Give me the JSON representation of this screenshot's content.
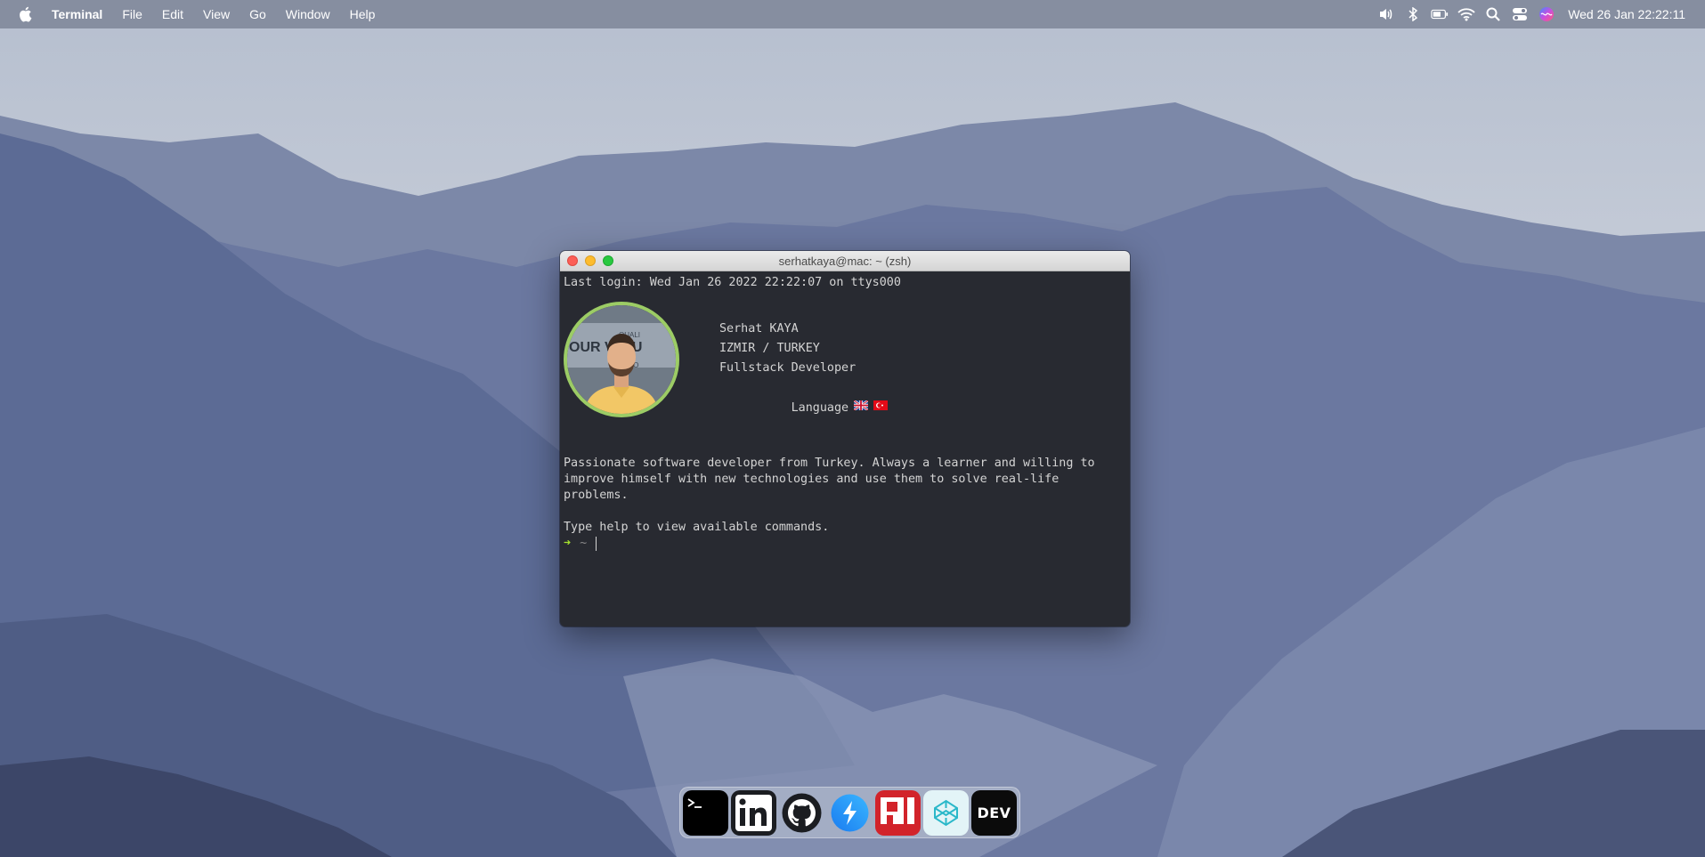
{
  "menubar": {
    "app_name": "Terminal",
    "menus": [
      "File",
      "Edit",
      "View",
      "Go",
      "Window",
      "Help"
    ],
    "status_icons": [
      "volume-icon",
      "bluetooth-icon",
      "battery-icon",
      "wifi-icon",
      "search-icon",
      "control-center-icon",
      "siri-icon"
    ],
    "clock": "Wed 26 Jan 22:22:11"
  },
  "terminal": {
    "title": "serhatkaya@mac: ~ (zsh)",
    "last_login": "Last login: Wed Jan 26 2022 22:22:07 on ttys000",
    "profile": {
      "name": "Serhat KAYA",
      "location": "IZMIR / TURKEY",
      "role": "Fullstack Developer",
      "language_label": "Language"
    },
    "bio": "Passionate software developer from Turkey. Always a learner and willing to improve himself with new technologies and use them to solve real-life problems.",
    "help_text": "Type help to view available commands.",
    "prompt_arrow": "➜",
    "prompt_dir": "~"
  },
  "dock": {
    "apps": [
      "terminal-app",
      "linkedin-app",
      "github-app",
      "messenger-app",
      "polywork-app",
      "codepen-app",
      "dev-app"
    ],
    "dev_label": "DEV"
  },
  "colors": {
    "terminal_bg": "#282a31",
    "prompt_arrow": "#a6e22e",
    "avatar_ring": "#9ccc65"
  }
}
